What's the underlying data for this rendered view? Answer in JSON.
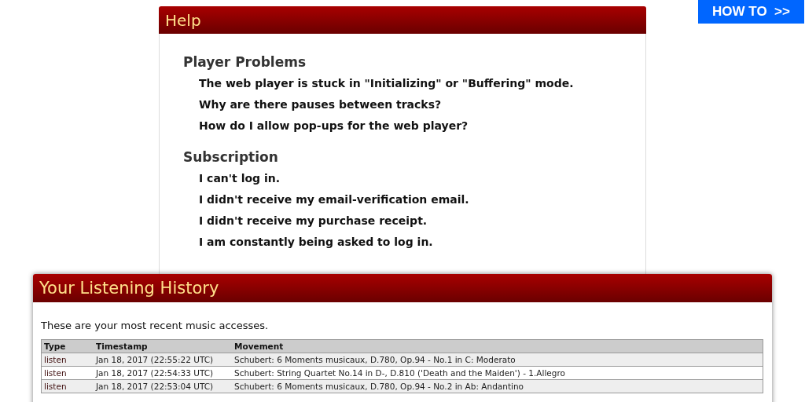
{
  "how_to_button": {
    "label": "HOW TO  >>"
  },
  "help": {
    "title": "Help",
    "sections": [
      {
        "heading": "Player Problems",
        "items": [
          "The web player is stuck in \"Initializing\" or \"Buffering\" mode.",
          "Why are there pauses between tracks?",
          "How do I allow pop-ups for the web player?"
        ]
      },
      {
        "heading": "Subscription",
        "items": [
          "I can't log in.",
          "I didn't receive my email-verification email.",
          "I didn't receive my purchase receipt.",
          "I am constantly being asked to log in."
        ]
      }
    ]
  },
  "history": {
    "title": "Your Listening History",
    "intro": "These are your most recent music accesses.",
    "table": {
      "columns": [
        "Type",
        "Timestamp",
        "Movement"
      ],
      "rows": [
        [
          "listen",
          "Jan 18, 2017 (22:55:22 UTC)",
          "Schubert: 6 Moments musicaux, D.780, Op.94 - No.1 in C: Moderato"
        ],
        [
          "listen",
          "Jan 18, 2017 (22:54:33 UTC)",
          "Schubert: String Quartet No.14 in D-, D.810 ('Death and the Maiden') - 1.Allegro"
        ],
        [
          "listen",
          "Jan 18, 2017 (22:53:04 UTC)",
          "Schubert: 6 Moments musicaux, D.780, Op.94 - No.2 in Ab: Andantino"
        ]
      ]
    }
  }
}
